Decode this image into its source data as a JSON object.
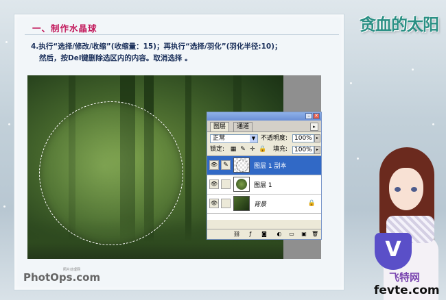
{
  "tutorial": {
    "section_title": "一、制作水晶球",
    "step_line1": "4.执行“选择/修改/收缩”(收缩量：15)；再执行“选择/羽化”(羽化半径:10)；",
    "step_line2": "然后，按Del键删除选区内的内容。取消选择 。"
  },
  "decor": {
    "logo_top": "贪血的太阳",
    "watermark_left": "PhotOps.com",
    "watermark_left_sub": "照片处理网",
    "watermark_right_cn": "飞特网",
    "watermark_right_en": "fevte.com",
    "v_badge": "V"
  },
  "layers_panel": {
    "tabs": [
      "图层",
      "通道"
    ],
    "blend_mode": "正常",
    "opacity_label": "不透明度:",
    "opacity_value": "100%",
    "lock_label": "锁定:",
    "fill_label": "填充:",
    "fill_value": "100%",
    "layers": [
      {
        "name": "图层 1 副本",
        "selected": true
      },
      {
        "name": "图层 1",
        "selected": false
      },
      {
        "name": "背景",
        "selected": false,
        "locked": true
      }
    ]
  },
  "icons": [
    "eye-icon",
    "brush-link-icon",
    "padlock-icon",
    "move-icon",
    "transparency-lock-icon",
    "layer-style-icon",
    "mask-icon",
    "adjustment-icon",
    "folder-icon",
    "new-layer-icon",
    "trash-icon"
  ],
  "colors": {
    "section_title": "#c2185b",
    "step_text": "#1a2f5a",
    "selected_layer": "#3169c6"
  }
}
